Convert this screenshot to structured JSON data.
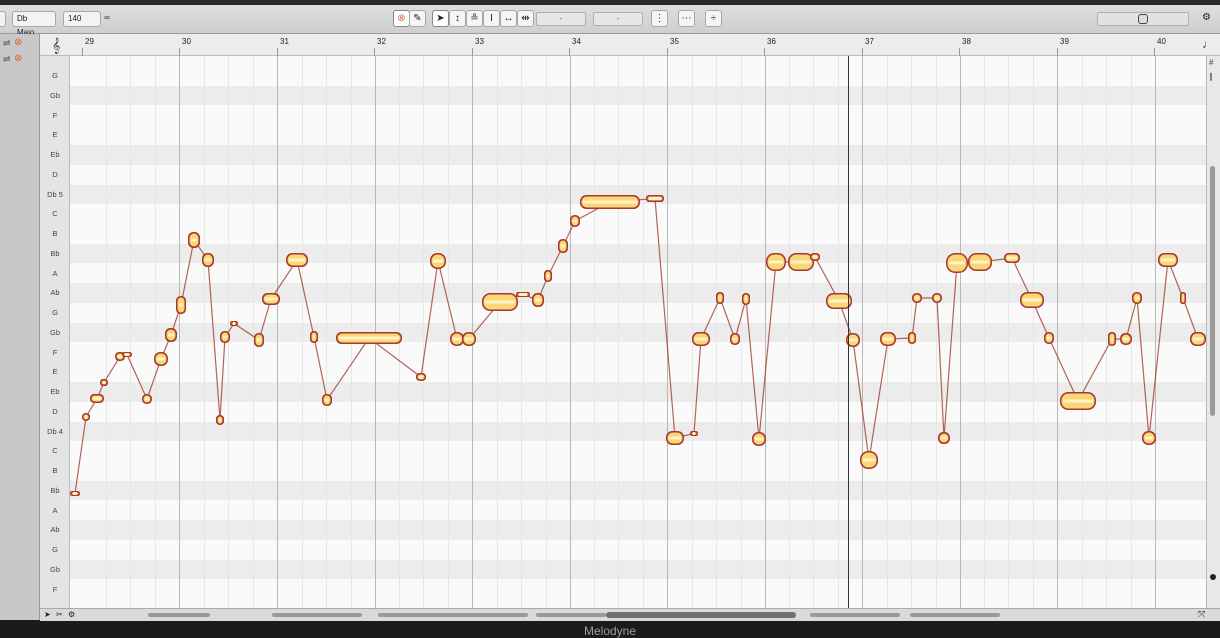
{
  "app": {
    "title": "Melodyne"
  },
  "toolbar": {
    "scale_label": "Db Majo...",
    "tempo_value": "140",
    "field_1": "-",
    "field_2": "-"
  },
  "ruler": {
    "bars": [
      "29",
      "30",
      "31",
      "32",
      "33",
      "34",
      "35",
      "36",
      "37",
      "38",
      "39",
      "40"
    ]
  },
  "pitch_lanes": [
    "G",
    "Gb",
    "F",
    "E",
    "Eb",
    "D",
    "Db 5",
    "C",
    "B",
    "Bb",
    "A",
    "Ab",
    "G",
    "Gb",
    "F",
    "E",
    "Eb",
    "D",
    "Db 4",
    "C",
    "B",
    "Bb",
    "A",
    "Ab",
    "G",
    "Gb",
    "F"
  ],
  "icons": {
    "link": "link-icon",
    "arrow_tool": "arrow-tool-icon",
    "pitch_tool": "pitch-tool-icon",
    "treble_clef": "treble-clef-icon",
    "settings": "gear-icon"
  },
  "colors": {
    "blob_outer": "#a8382a",
    "blob_inner": "#f9d67a",
    "blob_core": "#fff3c4",
    "pitch_line": "#9c3224",
    "link_accent": "#e0662f"
  }
}
